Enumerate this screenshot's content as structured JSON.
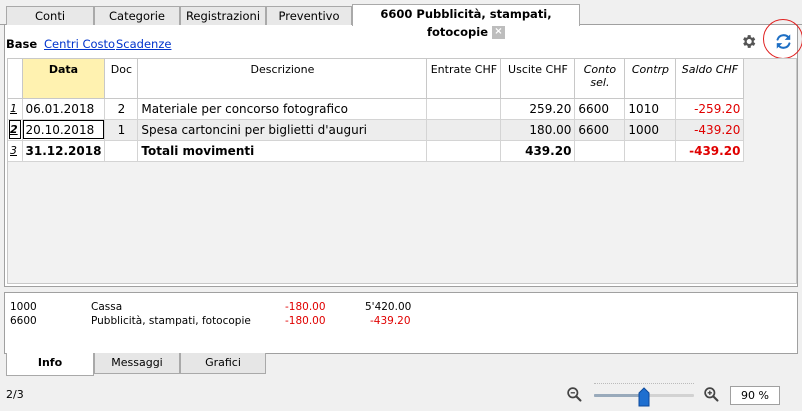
{
  "tabs": [
    {
      "label": "Conti"
    },
    {
      "label": "Categorie"
    },
    {
      "label": "Registrazioni"
    },
    {
      "label": "Preventivo"
    },
    {
      "label": "6600 Pubblicità, stampati, fotocopie"
    }
  ],
  "subnav": {
    "base": "Base",
    "centri_costo": "Centri Costo",
    "scadenze": "Scadenze"
  },
  "table": {
    "headers": {
      "data": "Data",
      "doc": "Doc",
      "descrizione": "Descrizione",
      "entrate": "Entrate CHF",
      "uscite": "Uscite CHF",
      "conto_sel": "Conto sel.",
      "contrp": "Contrp",
      "saldo": "Saldo CHF"
    },
    "rows": [
      {
        "n": "1",
        "data": "06.01.2018",
        "doc": "2",
        "descrizione": "Materiale per concorso fotografico",
        "entrate": "",
        "uscite": "259.20",
        "conto_sel": "6600",
        "contrp": "1010",
        "saldo": "-259.20"
      },
      {
        "n": "2",
        "data": "20.10.2018",
        "doc": "1",
        "descrizione": "Spesa cartoncini per biglietti d'auguri",
        "entrate": "",
        "uscite": "180.00",
        "conto_sel": "6600",
        "contrp": "1000",
        "saldo": "-439.20"
      },
      {
        "n": "3",
        "data": "31.12.2018",
        "doc": "",
        "descrizione": "Totali movimenti",
        "entrate": "",
        "uscite": "439.20",
        "conto_sel": "",
        "contrp": "",
        "saldo": "-439.20"
      }
    ]
  },
  "info": {
    "rows": [
      {
        "account": "1000",
        "name": "Cassa",
        "amount": "-180.00",
        "balance": "5'420.00"
      },
      {
        "account": "6600",
        "name": "Pubblicità, stampati, fotocopie",
        "amount": "-180.00",
        "balance": "-439.20"
      }
    ]
  },
  "bottom_tabs": [
    {
      "label": "Info"
    },
    {
      "label": "Messaggi"
    },
    {
      "label": "Grafici"
    }
  ],
  "status": {
    "page": "2/3",
    "zoom": "90",
    "zoom_unit": "%",
    "zoom_level": 0.5
  },
  "colors": {
    "negative": "#e00000",
    "link": "#0033cc",
    "header_highlight": "#fff2b0",
    "refresh_icon": "#1e6fc4",
    "annotation_circle": "#e02020"
  }
}
